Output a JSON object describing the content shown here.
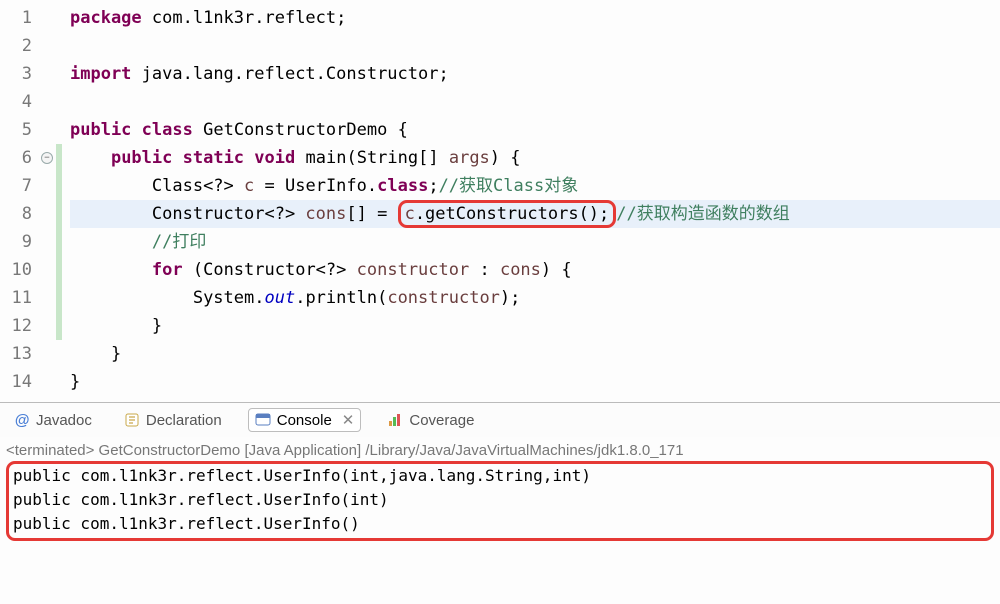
{
  "code": {
    "lines": [
      {
        "n": 1
      },
      {
        "n": 2
      },
      {
        "n": 3
      },
      {
        "n": 4
      },
      {
        "n": 5
      },
      {
        "n": 6
      },
      {
        "n": 7
      },
      {
        "n": 8
      },
      {
        "n": 9
      },
      {
        "n": 10
      },
      {
        "n": 11
      },
      {
        "n": 12
      },
      {
        "n": 13
      },
      {
        "n": 14
      }
    ],
    "tokens": {
      "package": "package",
      "import": "import",
      "public": "public",
      "class": "class",
      "static": "static",
      "void": "void",
      "for": "for",
      "className": "GetConstructorDemo",
      "main": "main",
      "stringArr": "String[]",
      "args": "args",
      "classType": "Class<?>",
      "c": "c",
      "userInfoClass": "UserInfo.",
      "classField": "class",
      "consDecl": "Constructor<?> ",
      "consVar": "cons",
      "brackets": "[] = ",
      "getCons": "c.getConstructors();",
      "constructorType": "Constructor<?>",
      "constructorVar": "constructor",
      "consRef": "cons",
      "sysout_a": "System.",
      "sysout_out": "out",
      "sysout_b": ".println(",
      "sysout_arg": "constructor",
      "pkgPath": "com.l1nk3r.reflect;",
      "importPath": "java.lang.reflect.Constructor;",
      "comment7": "//获取Class对象",
      "comment8": "//获取构造函数的数组",
      "comment9": "//打印",
      "close12": "}",
      "close13": "}",
      "close14": "}"
    }
  },
  "tabs": {
    "javadoc": "Javadoc",
    "declaration": "Declaration",
    "console": "Console",
    "coverage": "Coverage"
  },
  "console": {
    "status": "<terminated> GetConstructorDemo [Java Application] /Library/Java/JavaVirtualMachines/jdk1.8.0_171",
    "out1": "public com.l1nk3r.reflect.UserInfo(int,java.lang.String,int)",
    "out2": "public com.l1nk3r.reflect.UserInfo(int)",
    "out3": "public com.l1nk3r.reflect.UserInfo()"
  }
}
